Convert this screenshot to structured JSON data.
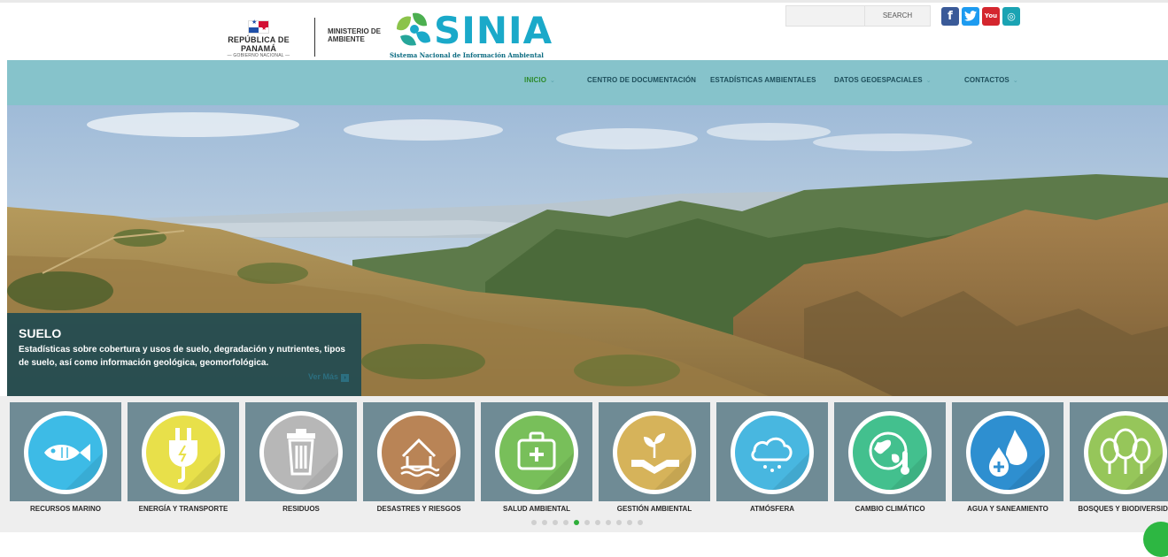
{
  "header": {
    "gov_name": "REPÚBLICA DE PANAMÁ",
    "gov_sub": "— GOBIERNO NACIONAL —",
    "ministry_line1": "MINISTERIO DE",
    "ministry_line2": "AMBIENTE",
    "logo_word": "SINIA",
    "logo_sub": "Sistema Nacional de Información Ambiental",
    "search": {
      "placeholder": "",
      "button": "SEARCH"
    },
    "social": [
      {
        "name": "facebook",
        "glyph": "f"
      },
      {
        "name": "twitter",
        "glyph": "t"
      },
      {
        "name": "youtube",
        "glyph": "You"
      },
      {
        "name": "instagram",
        "glyph": "◎"
      }
    ]
  },
  "nav": {
    "items": [
      {
        "label": "INICIO",
        "active": true,
        "has_menu": true
      },
      {
        "label": "CENTRO DE DOCUMENTACIÓN",
        "active": false,
        "has_menu": false
      },
      {
        "label": "ESTADÍSTICAS AMBIENTALES",
        "active": false,
        "has_menu": false
      },
      {
        "label": "DATOS GEOESPACIALES",
        "active": false,
        "has_menu": true
      },
      {
        "label": "CONTACTOS",
        "active": false,
        "has_menu": true
      }
    ]
  },
  "hero": {
    "title": "SUELO",
    "text": "Estadísticas sobre cobertura y usos de suelo, degradación y nutrientes, tipos de suelo, así como información geológica, geomorfológica.",
    "more": "Ver Más"
  },
  "categories": [
    {
      "label": "RECURSOS MARINO",
      "icon": "fish-icon",
      "color": "#3dbbe6"
    },
    {
      "label": "ENERGÍA Y TRANSPORTE",
      "icon": "plug-icon",
      "color": "#e8e04a"
    },
    {
      "label": "RESIDUOS",
      "icon": "trash-icon",
      "color": "#b7b7b7"
    },
    {
      "label": "DESASTRES Y RIESGOS",
      "icon": "flood-house-icon",
      "color": "#b98456"
    },
    {
      "label": "SALUD AMBIENTAL",
      "icon": "first-aid-icon",
      "color": "#78bf5a"
    },
    {
      "label": "GESTIÓN AMBIENTAL",
      "icon": "plant-hands-icon",
      "color": "#d6b35a"
    },
    {
      "label": "ATMÓSFERA",
      "icon": "cloud-rain-icon",
      "color": "#48b7e0"
    },
    {
      "label": "CAMBIO CLIMÁTICO",
      "icon": "globe-thermometer-icon",
      "color": "#43c08e"
    },
    {
      "label": "AGUA Y SANEAMIENTO",
      "icon": "water-drops-icon",
      "color": "#2e8fd0"
    },
    {
      "label": "BOSQUES Y BIODIVERSIDA",
      "icon": "trees-icon",
      "color": "#96c65a"
    }
  ],
  "carousel": {
    "total": 11,
    "active_index": 4
  }
}
